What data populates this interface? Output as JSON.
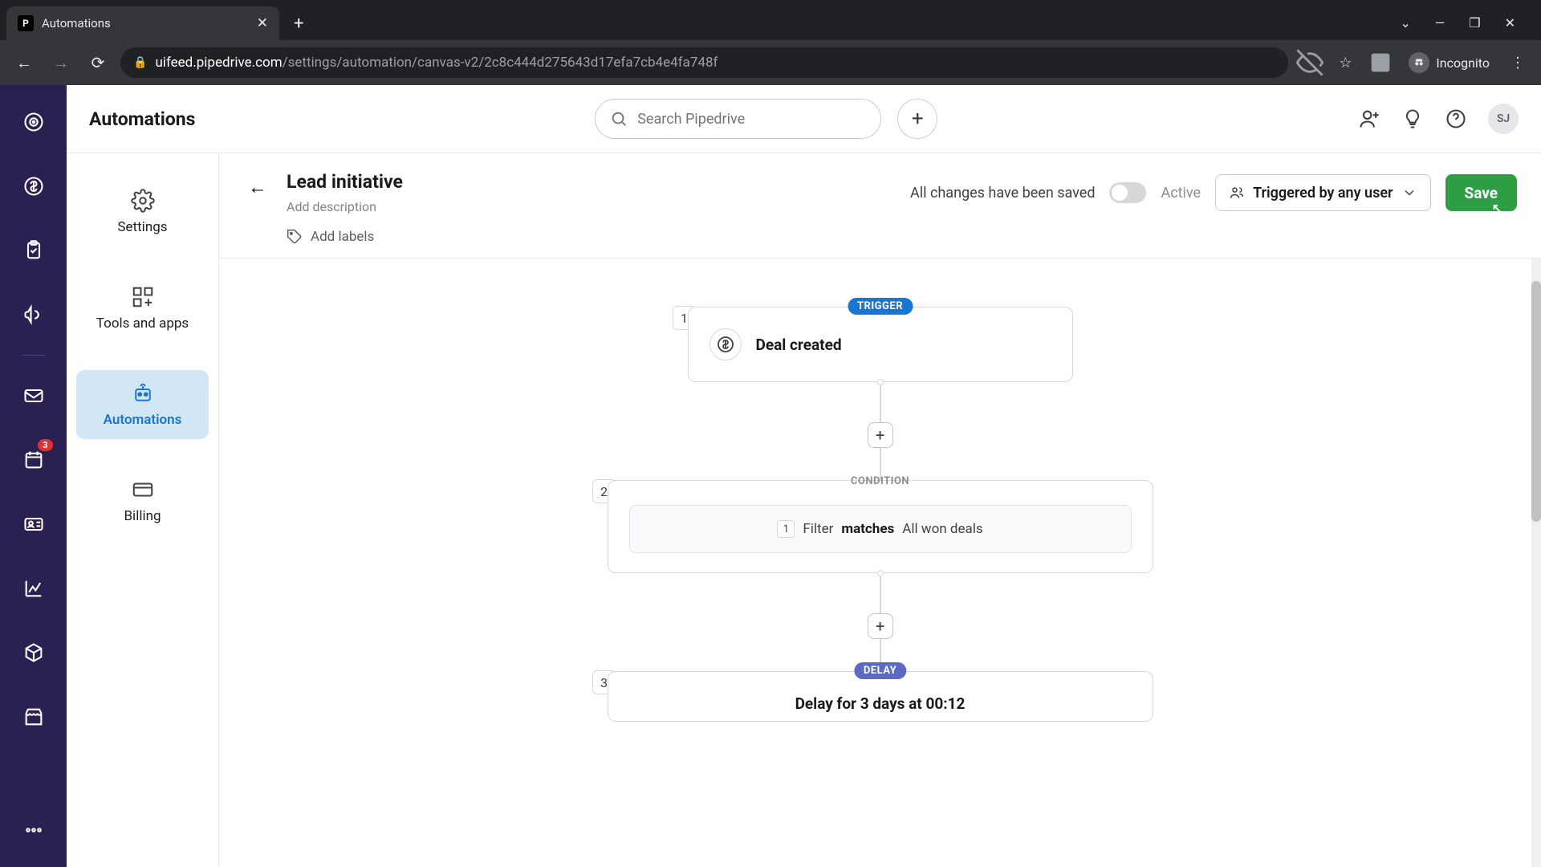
{
  "browser": {
    "tab_title": "Automations",
    "url_domain": "uifeed.pipedrive.com",
    "url_path": "/settings/automation/canvas-v2/2c8c444d275643d17efa7cb4e4fa748f",
    "incognito_label": "Incognito"
  },
  "app_bar": {
    "title": "Automations",
    "search_placeholder": "Search Pipedrive",
    "avatar_initials": "SJ"
  },
  "left_rail": {
    "badge_count": "3"
  },
  "sidebar": {
    "items": [
      {
        "label": "Settings"
      },
      {
        "label": "Tools and apps"
      },
      {
        "label": "Automations"
      },
      {
        "label": "Billing"
      }
    ]
  },
  "editor": {
    "title": "Lead initiative",
    "add_description": "Add description",
    "add_labels": "Add labels",
    "saved_text": "All changes have been saved",
    "active_label": "Active",
    "trigger_dropdown_label": "Triggered by any user",
    "save_button_label": "Save"
  },
  "canvas": {
    "steps": [
      {
        "num": "1",
        "tag": "TRIGGER",
        "title": "Deal created"
      },
      {
        "num": "2",
        "tag": "CONDITION",
        "filter_num": "1",
        "filter_label": "Filter",
        "matches_label": "matches",
        "filter_value": "All won deals"
      },
      {
        "num": "3",
        "tag": "DELAY",
        "title": "Delay for 3 days at 00:12"
      }
    ]
  }
}
